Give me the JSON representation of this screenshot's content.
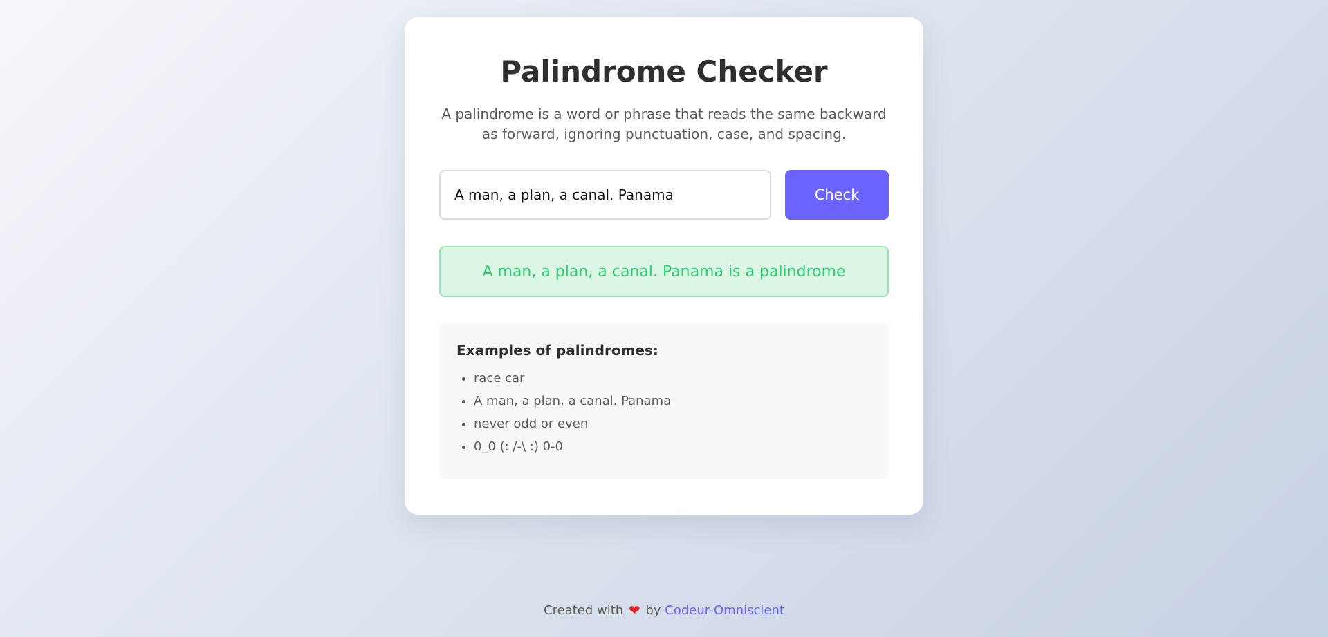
{
  "card": {
    "title": "Palindrome Checker",
    "description": "A palindrome is a word or phrase that reads the same backward as forward, ignoring punctuation, case, and spacing."
  },
  "form": {
    "input_value": "A man, a plan, a canal. Panama",
    "check_label": "Check"
  },
  "result": {
    "text": "A man, a plan, a canal. Panama is a palindrome",
    "status": "success",
    "color": "#2ecc71"
  },
  "examples": {
    "title": "Examples of palindromes:",
    "items": [
      "race car",
      "A man, a plan, a canal. Panama",
      "never odd or even",
      "0_0 (: /-\\ :) 0-0"
    ]
  },
  "footer": {
    "prefix": "Created with",
    "icon": "heart-icon",
    "by": "by",
    "author": "Codeur-Omniscient"
  },
  "colors": {
    "accent": "#6c63ff",
    "success": "#2ecc71",
    "heart": "#e0202a"
  }
}
